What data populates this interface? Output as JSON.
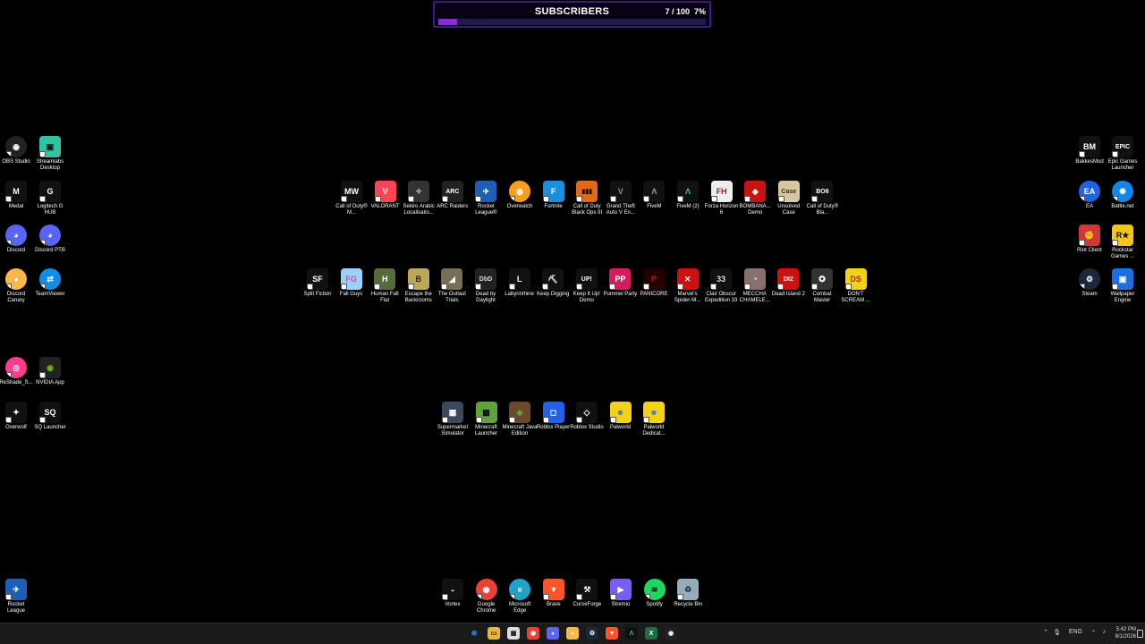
{
  "widget": {
    "title": "SUBSCRIBERS",
    "count": "7 / 100",
    "percent": "7%",
    "progress": 0.07
  },
  "icons": {
    "left": [
      {
        "label": "OBS Studio",
        "name": "obs-studio-icon",
        "bg": "#222",
        "fg": "#fff",
        "glyph": "◉",
        "round": true
      },
      {
        "label": "Streamlabs Desktop",
        "name": "streamlabs-icon",
        "bg": "#31c3a2",
        "fg": "#09161d",
        "glyph": "▣"
      },
      {
        "label": "Medal",
        "name": "medal-icon",
        "bg": "#111",
        "fg": "#fff",
        "glyph": "M"
      },
      {
        "label": "Logitech G HUB",
        "name": "logitech-g-hub-icon",
        "bg": "#111",
        "fg": "#fff",
        "glyph": "G"
      },
      {
        "label": "Discord",
        "name": "discord-icon",
        "bg": "#5865f2",
        "fg": "#fff",
        "glyph": "◕",
        "round": true
      },
      {
        "label": "Discord PTB",
        "name": "discord-ptb-icon",
        "bg": "#5865f2",
        "fg": "#fff",
        "glyph": "◕",
        "round": true
      },
      {
        "label": "Discord Canary",
        "name": "discord-canary-icon",
        "bg": "#fbb848",
        "fg": "#fff",
        "glyph": "◕",
        "round": true
      },
      {
        "label": "TeamViewer",
        "name": "teamviewer-icon",
        "bg": "#0e8ee9",
        "fg": "#fff",
        "glyph": "⇄",
        "round": true
      },
      {
        "label": "ReShade_S...",
        "name": "reshade-icon",
        "bg": "#ff3b8b",
        "fg": "#fff",
        "glyph": "◎",
        "round": true
      },
      {
        "label": "NVIDIA App",
        "name": "nvidia-app-icon",
        "bg": "#222",
        "fg": "#76b900",
        "glyph": "◉"
      },
      {
        "label": "Overwolf",
        "name": "overwolf-icon",
        "bg": "#111",
        "fg": "#fff",
        "glyph": "✦"
      },
      {
        "label": "SQ Launcher",
        "name": "sq-launcher-icon",
        "bg": "#111",
        "fg": "#fff",
        "glyph": "SQ"
      },
      {
        "label": "Rocket League",
        "name": "rocket-league-icon",
        "bg": "#1c5fb5",
        "fg": "#fff",
        "glyph": "✈"
      }
    ],
    "row1": [
      {
        "label": "Call of Duty® M...",
        "name": "cod-mw-icon",
        "bg": "#111",
        "fg": "#fff",
        "glyph": "MW"
      },
      {
        "label": "VALORANT",
        "name": "valorant-icon",
        "bg": "#fd4556",
        "fg": "#fff",
        "glyph": "V"
      },
      {
        "label": "Sekiro Arabic Localisatio...",
        "name": "sekiro-icon",
        "bg": "#333",
        "fg": "#ddd",
        "glyph": "✧"
      },
      {
        "label": "ARC Raiders",
        "name": "arc-raiders-icon",
        "bg": "#222",
        "fg": "#fff",
        "glyph": "ARC"
      },
      {
        "label": "Rocket League®",
        "name": "rocket-league-game-icon",
        "bg": "#1c5fb5",
        "fg": "#fff",
        "glyph": "✈"
      },
      {
        "label": "Overwatch",
        "name": "overwatch-icon",
        "bg": "#f99e1a",
        "fg": "#fff",
        "glyph": "◍",
        "round": true
      },
      {
        "label": "Fortnite",
        "name": "fortnite-icon",
        "bg": "#1a8fe0",
        "fg": "#fff",
        "glyph": "F"
      },
      {
        "label": "Call of Duty Black Ops III",
        "name": "cod-bo3-icon",
        "bg": "#e36a12",
        "fg": "#111",
        "glyph": "▮▮▮"
      },
      {
        "label": "Grand Theft Auto V En...",
        "name": "gta-v-icon",
        "bg": "#111",
        "fg": "#5bb749",
        "glyph": "V"
      },
      {
        "label": "FiveM",
        "name": "fivem-icon",
        "bg": "#111",
        "fg": "#43d17a",
        "glyph": "Λ"
      },
      {
        "label": "FiveM (2)",
        "name": "fivem-2-icon",
        "bg": "#111",
        "fg": "#43d17a",
        "glyph": "Λ"
      },
      {
        "label": "Forza Horizon 6",
        "name": "forza-horizon-icon",
        "bg": "#eee",
        "fg": "#c10",
        "glyph": "FH"
      },
      {
        "label": "BOMBANA... Demo",
        "name": "bombana-demo-icon",
        "bg": "#c11",
        "fg": "#fff",
        "glyph": "◆"
      },
      {
        "label": "Unsolved Case",
        "name": "unsolved-case-icon",
        "bg": "#d8c6a0",
        "fg": "#3a2a10",
        "glyph": "Case"
      },
      {
        "label": "Call of Duty® Bla...",
        "name": "cod-bo6-icon",
        "bg": "#111",
        "fg": "#fff",
        "glyph": "BO6"
      }
    ],
    "row2": [
      {
        "label": "Split Fiction",
        "name": "split-fiction-icon",
        "bg": "#111",
        "fg": "#fff",
        "glyph": "SF"
      },
      {
        "label": "Fall Guys",
        "name": "fall-guys-icon",
        "bg": "#9bd3ff",
        "fg": "#e8439a",
        "glyph": "FG"
      },
      {
        "label": "Human Fall Flat",
        "name": "human-fall-flat-icon",
        "bg": "#556b3a",
        "fg": "#fff",
        "glyph": "H"
      },
      {
        "label": "Escape the Backrooms",
        "name": "escape-backrooms-icon",
        "bg": "#bba65a",
        "fg": "#222",
        "glyph": "B"
      },
      {
        "label": "The Outlast Trials",
        "name": "outlast-trials-icon",
        "bg": "#776f55",
        "fg": "#fff",
        "glyph": "◢"
      },
      {
        "label": "Dead by Daylight",
        "name": "dead-by-daylight-icon",
        "bg": "#222",
        "fg": "#ddd",
        "glyph": "DbD"
      },
      {
        "label": "Labyrinthine",
        "name": "labyrinthine-icon",
        "bg": "#111",
        "fg": "#fff",
        "glyph": "L"
      },
      {
        "label": "Keep Digging",
        "name": "keep-digging-icon",
        "bg": "#111",
        "fg": "#fff",
        "glyph": "⛏"
      },
      {
        "label": "Keep It Up! Demo",
        "name": "keep-it-up-icon",
        "bg": "#111",
        "fg": "#fff",
        "glyph": "UP!"
      },
      {
        "label": "Pummel Party",
        "name": "pummel-party-icon",
        "bg": "#d81b60",
        "fg": "#fff",
        "glyph": "PP"
      },
      {
        "label": "PANICORE",
        "name": "panicore-icon",
        "bg": "#220000",
        "fg": "#c11",
        "glyph": "P"
      },
      {
        "label": "Marvel's Spider-M...",
        "name": "spider-man-icon",
        "bg": "#c11",
        "fg": "#fff",
        "glyph": "✕"
      },
      {
        "label": "Clair Obscur Expedition 33",
        "name": "clair-obscur-icon",
        "bg": "#111",
        "fg": "#ddd",
        "glyph": "33"
      },
      {
        "label": "MECCHA CHAMELE...",
        "name": "meccha-chameleon-icon",
        "bg": "#8a6f6f",
        "fg": "#fff",
        "glyph": "◔"
      },
      {
        "label": "Dead Island 2",
        "name": "dead-island-2-icon",
        "bg": "#c11",
        "fg": "#fff",
        "glyph": "DI2"
      },
      {
        "label": "Combat Master",
        "name": "combat-master-icon",
        "bg": "#333",
        "fg": "#fff",
        "glyph": "✪"
      },
      {
        "label": "DON'T SCREAM ...",
        "name": "dont-scream-icon",
        "bg": "#f0d41a",
        "fg": "#c11",
        "glyph": "DS"
      }
    ],
    "row3": [
      {
        "label": "Supermarket Simulator",
        "name": "supermarket-simulator-icon",
        "bg": "#3a4a5a",
        "fg": "#fff",
        "glyph": "▦"
      },
      {
        "label": "Minecraft Launcher",
        "name": "minecraft-launcher-icon",
        "bg": "#5fa33a",
        "fg": "#111",
        "glyph": "▩"
      },
      {
        "label": "Minecraft Java Edition",
        "name": "minecraft-java-icon",
        "bg": "#6b4a2b",
        "fg": "#5fa33a",
        "glyph": "◆"
      },
      {
        "label": "Roblox Player",
        "name": "roblox-player-icon",
        "bg": "#2560e8",
        "fg": "#fff",
        "glyph": "◻"
      },
      {
        "label": "Roblox Studio",
        "name": "roblox-studio-icon",
        "bg": "#111",
        "fg": "#fff",
        "glyph": "◇"
      },
      {
        "label": "Palworld",
        "name": "palworld-icon",
        "bg": "#f5d21a",
        "fg": "#3a7ad8",
        "glyph": "☻"
      },
      {
        "label": "Palworld Dedicat...",
        "name": "palworld-dedicated-icon",
        "bg": "#f5d21a",
        "fg": "#3a7ad8",
        "glyph": "☻"
      }
    ],
    "right": [
      {
        "label": "BakkesMod",
        "name": "bakkesmod-icon",
        "bg": "#111",
        "fg": "#fff",
        "glyph": "BM"
      },
      {
        "label": "Epic Games Launcher",
        "name": "epic-games-icon",
        "bg": "#111",
        "fg": "#fff",
        "glyph": "EPIC"
      },
      {
        "label": "EA",
        "name": "ea-icon",
        "bg": "#1f63e0",
        "fg": "#fff",
        "glyph": "EA",
        "round": true
      },
      {
        "label": "Battle.net",
        "name": "battle-net-icon",
        "bg": "#1485e8",
        "fg": "#fff",
        "glyph": "✺",
        "round": true
      },
      {
        "label": "Riot Client",
        "name": "riot-client-icon",
        "bg": "#d13639",
        "fg": "#fff",
        "glyph": "✊"
      },
      {
        "label": "Rockstar Games ...",
        "name": "rockstar-games-icon",
        "bg": "#f5c518",
        "fg": "#111",
        "glyph": "R★"
      },
      {
        "label": "Steam",
        "name": "steam-icon",
        "bg": "#1b2838",
        "fg": "#fff",
        "glyph": "⚙",
        "round": true
      },
      {
        "label": "Wallpaper Engine",
        "name": "wallpaper-engine-icon",
        "bg": "#1b6fe0",
        "fg": "#fff",
        "glyph": "▣"
      }
    ],
    "bottom": [
      {
        "label": "Vortex",
        "name": "vortex-icon",
        "bg": "#111",
        "fg": "#e8b24a",
        "glyph": "◒"
      },
      {
        "label": "Google Chrome",
        "name": "google-chrome-icon",
        "bg": "#e94235",
        "fg": "#fff",
        "glyph": "◉",
        "round": true
      },
      {
        "label": "Microsoft Edge",
        "name": "microsoft-edge-icon",
        "bg": "#1fa3c9",
        "fg": "#fff",
        "glyph": "e",
        "round": true
      },
      {
        "label": "Brave",
        "name": "brave-icon",
        "bg": "#fb542b",
        "fg": "#fff",
        "glyph": "▼"
      },
      {
        "label": "CurseForge",
        "name": "curseforge-icon",
        "bg": "#111",
        "fg": "#fff",
        "glyph": "⚒"
      },
      {
        "label": "Stremio",
        "name": "stremio-icon",
        "bg": "#7b5bf5",
        "fg": "#fff",
        "glyph": "▶"
      },
      {
        "label": "Spotify",
        "name": "spotify-icon",
        "bg": "#1ed760",
        "fg": "#111",
        "glyph": "≋",
        "round": true
      },
      {
        "label": "Recycle Bin",
        "name": "recycle-bin-icon",
        "bg": "#9ab",
        "fg": "#234",
        "glyph": "♻"
      }
    ]
  },
  "taskbar": {
    "apps": [
      {
        "name": "start-button",
        "bg": "#1b1b1b",
        "fg": "#3aa0ff",
        "glyph": "⊞"
      },
      {
        "name": "file-explorer-icon",
        "bg": "#e8b53a",
        "fg": "#111",
        "glyph": "▭"
      },
      {
        "name": "microsoft-store-icon",
        "bg": "#ddd",
        "fg": "#111",
        "glyph": "▦"
      },
      {
        "name": "chrome-taskbar-icon",
        "bg": "#e94235",
        "fg": "#fff",
        "glyph": "◉"
      },
      {
        "name": "discord-taskbar-icon",
        "bg": "#5865f2",
        "fg": "#fff",
        "glyph": "◕"
      },
      {
        "name": "discord-canary-taskbar-icon",
        "bg": "#fbb848",
        "fg": "#fff",
        "glyph": "◕"
      },
      {
        "name": "steam-taskbar-icon",
        "bg": "#1b2838",
        "fg": "#fff",
        "glyph": "⚙"
      },
      {
        "name": "brave-taskbar-icon",
        "bg": "#fb542b",
        "fg": "#fff",
        "glyph": "▼"
      },
      {
        "name": "fivem-taskbar-icon",
        "bg": "#111",
        "fg": "#43d17a",
        "glyph": "Λ"
      },
      {
        "name": "excel-taskbar-icon",
        "bg": "#1d6f42",
        "fg": "#fff",
        "glyph": "X"
      },
      {
        "name": "obs-taskbar-icon",
        "bg": "#222",
        "fg": "#fff",
        "glyph": "◉"
      }
    ],
    "tray": {
      "lang": "ENG",
      "chevron": "⌃",
      "mic": "🎙",
      "wifi": "◔",
      "volume": "♪"
    },
    "time": "5:42 PM",
    "date": "8/1/2026"
  }
}
